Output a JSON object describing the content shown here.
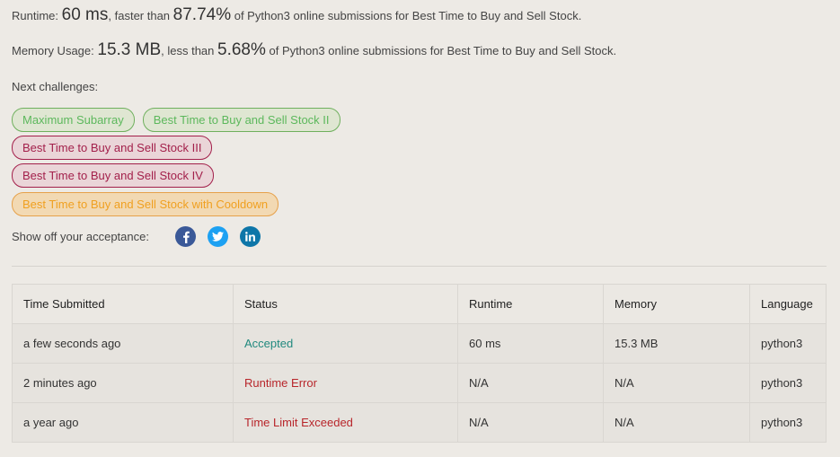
{
  "runtime": {
    "prefix": "Runtime: ",
    "value": "60 ms",
    "mid": ", faster than ",
    "percent": "87.74%",
    "suffix": " of Python3 online submissions for Best Time to Buy and Sell Stock."
  },
  "memory": {
    "prefix": "Memory Usage: ",
    "value": "15.3 MB",
    "mid": ", less than ",
    "percent": "5.68%",
    "suffix": " of Python3 online submissions for Best Time to Buy and Sell Stock."
  },
  "next_challenges": {
    "label": "Next challenges:",
    "items": [
      {
        "label": "Maximum Subarray",
        "difficulty": "easy",
        "color": "#5cb85c"
      },
      {
        "label": "Best Time to Buy and Sell Stock II",
        "difficulty": "easy",
        "color": "#5cb85c"
      },
      {
        "label": "Best Time to Buy and Sell Stock III",
        "difficulty": "hard",
        "color": "#a3204b"
      },
      {
        "label": "Best Time to Buy and Sell Stock IV",
        "difficulty": "hard",
        "color": "#a3204b"
      },
      {
        "label": "Best Time to Buy and Sell Stock with Cooldown",
        "difficulty": "medium",
        "color": "#f0a020"
      }
    ]
  },
  "share": {
    "label": "Show off your acceptance:",
    "icons": [
      "facebook-icon",
      "twitter-icon",
      "linkedin-icon"
    ]
  },
  "submissions": {
    "headers": [
      "Time Submitted",
      "Status",
      "Runtime",
      "Memory",
      "Language"
    ],
    "rows": [
      {
        "time": "a few seconds ago",
        "status": "Accepted",
        "runtime": "60 ms",
        "memory": "15.3 MB",
        "language": "python3"
      },
      {
        "time": "2 minutes ago",
        "status": "Runtime Error",
        "runtime": "N/A",
        "memory": "N/A",
        "language": "python3"
      },
      {
        "time": "a year ago",
        "status": "Time Limit Exceeded",
        "runtime": "N/A",
        "memory": "N/A",
        "language": "python3"
      }
    ]
  },
  "colors": {
    "accepted": "#21897e",
    "error": "#b8262b",
    "background": "#edeae5"
  }
}
